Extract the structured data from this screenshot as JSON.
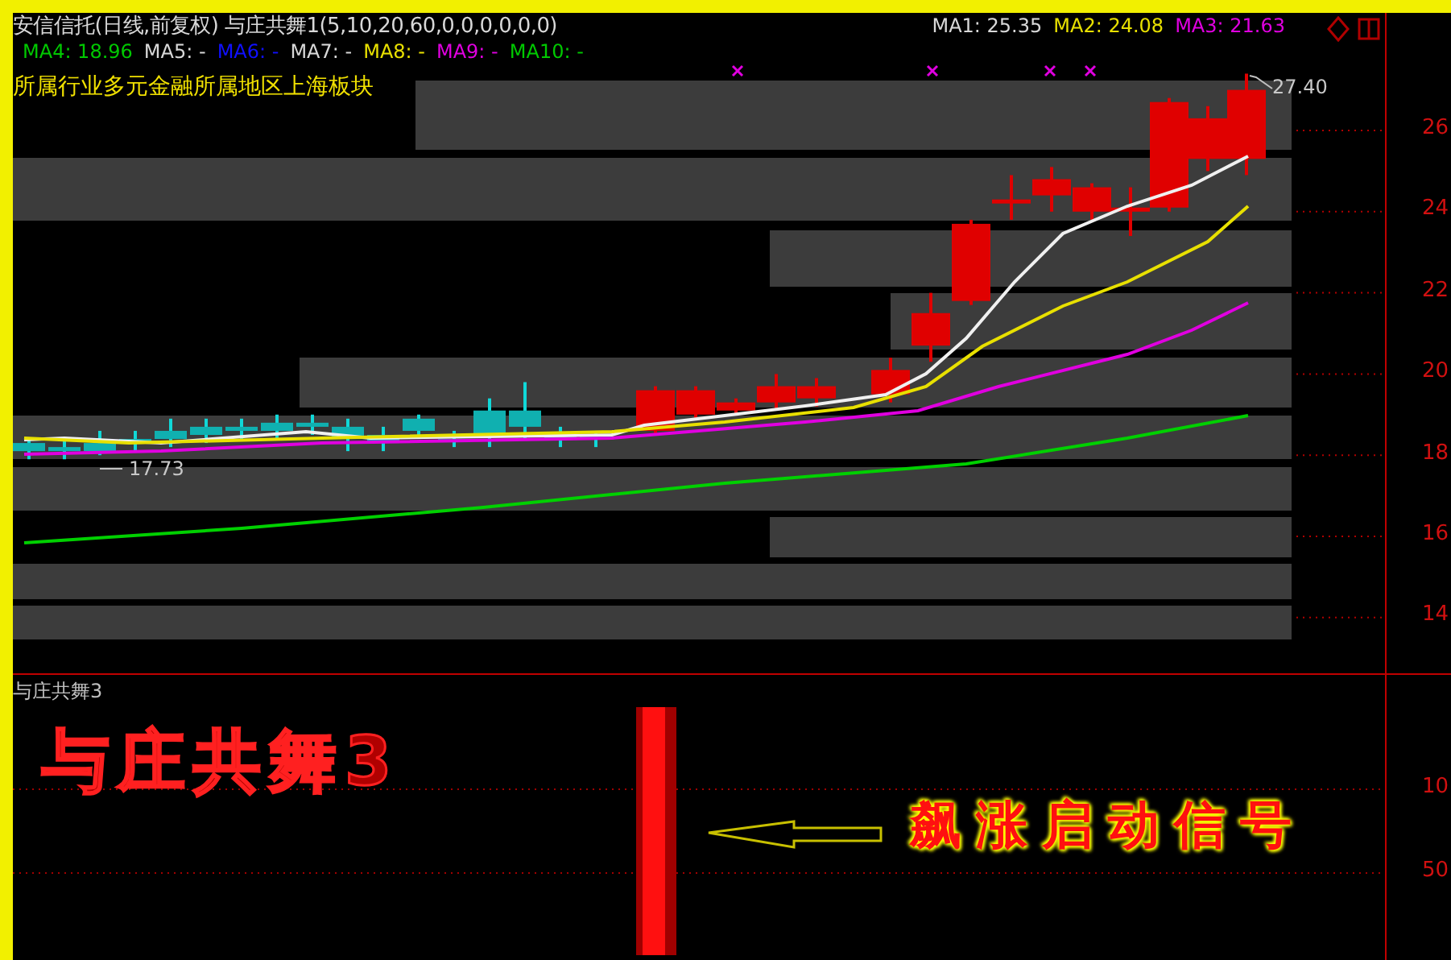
{
  "chart": {
    "title": "安信信托(日线,前复权) 与庄共舞1(5,10,20,60,0,0,0,0,0,0)",
    "ma_legend_right": [
      {
        "label": "MA1: 25.35",
        "color": "#d8d8d8"
      },
      {
        "label": "MA2: 24.08",
        "color": "#e8e000"
      },
      {
        "label": "MA3: 21.63",
        "color": "#e000e0"
      }
    ],
    "ma_legend": [
      {
        "label": "MA4: 18.96",
        "color": "#00c800"
      },
      {
        "label": "MA5: -",
        "color": "#d8d8d8"
      },
      {
        "label": "MA6: -",
        "color": "#1010ff"
      },
      {
        "label": "MA7: -",
        "color": "#d8d8d8"
      },
      {
        "label": "MA8: -",
        "color": "#e8e000"
      },
      {
        "label": "MA9: -",
        "color": "#e000e0"
      },
      {
        "label": "MA10: -",
        "color": "#00c800"
      }
    ],
    "info": "所属行业多元金融所属地区上海板块",
    "high_marker": "27.40",
    "low_marker": "17.73",
    "axis_ticks": [
      "26",
      "24",
      "22",
      "20",
      "18",
      "16",
      "14"
    ]
  },
  "indicator": {
    "title": "与庄共舞3",
    "banner": "与庄共舞3",
    "signal_label": "飙涨启动信号",
    "axis_ticks": [
      "10",
      "50"
    ]
  }
}
